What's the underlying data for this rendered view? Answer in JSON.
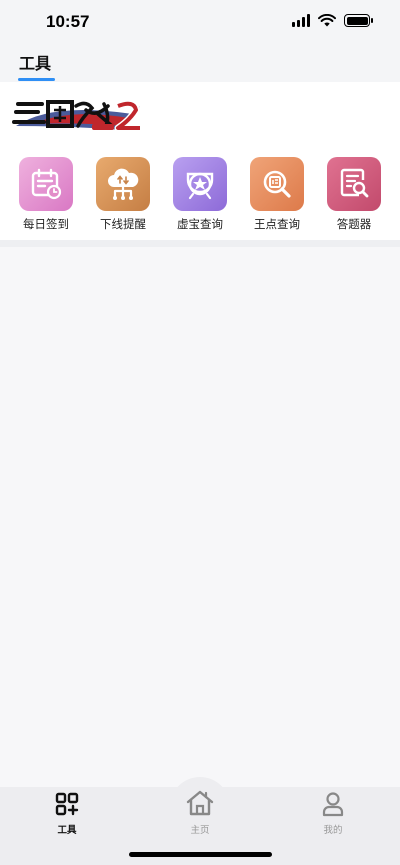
{
  "status": {
    "time": "10:57"
  },
  "header": {
    "tab_label": "工具"
  },
  "game": {
    "logo_alt": "三国群英传2"
  },
  "tools": [
    {
      "label": "每日签到",
      "icon": "calendar-check-icon",
      "color": "#e79ad0"
    },
    {
      "label": "下线提醒",
      "icon": "cloud-network-icon",
      "color": "#d9975c"
    },
    {
      "label": "虚宝查询",
      "icon": "star-shield-icon",
      "color": "#a98ae6"
    },
    {
      "label": "王点查询",
      "icon": "search-card-icon",
      "color": "#e98f60"
    },
    {
      "label": "答题器",
      "icon": "document-search-icon",
      "color": "#d45c7c"
    }
  ],
  "nav": [
    {
      "label": "工具",
      "icon": "tools-grid-icon",
      "active": true
    },
    {
      "label": "主页",
      "icon": "home-icon",
      "active": false
    },
    {
      "label": "我的",
      "icon": "user-icon",
      "active": false
    }
  ]
}
